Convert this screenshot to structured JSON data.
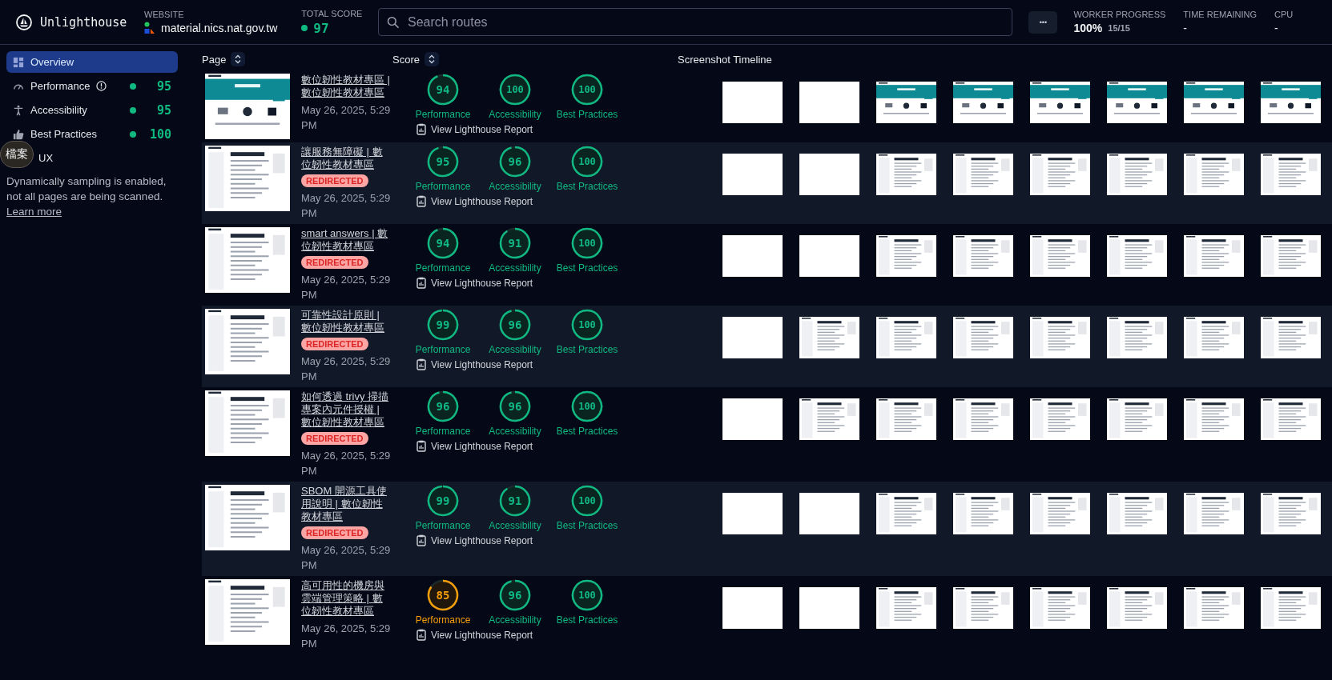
{
  "header": {
    "title": "Unlighthouse",
    "website_label": "WEBSITE",
    "website": "material.nics.nat.gov.tw",
    "total_score_label": "TOTAL SCORE",
    "total_score": "97",
    "search": {
      "placeholder": "Search routes"
    },
    "more_button": "•••",
    "worker_progress_label": "WORKER PROGRESS",
    "worker_progress": "100%",
    "worker_count": "15/15",
    "time_remaining_label": "TIME REMAINING",
    "time_remaining": "-",
    "cpu_label": "CPU",
    "cpu": "-"
  },
  "sidebar": {
    "items": [
      {
        "kind": "overview",
        "label": "Overview",
        "selected": true,
        "alert": false
      },
      {
        "kind": "performance",
        "label": "Performance",
        "selected": false,
        "alert": true,
        "score": "95"
      },
      {
        "kind": "accessibility",
        "label": "Accessibility",
        "selected": false,
        "alert": false,
        "score": "95"
      },
      {
        "kind": "best-practices",
        "label": "Best Practices",
        "selected": false,
        "alert": false,
        "score": "100"
      },
      {
        "kind": "ux",
        "label": "UX",
        "selected": false,
        "alert": false
      }
    ],
    "tooltip": "檔案",
    "note": "Dynamically sampling is enabled, not all pages are being scanned.",
    "note_link": "Learn more"
  },
  "table": {
    "columns": [
      "Page",
      "Score",
      "Screenshot Timeline"
    ],
    "rows": [
      {
        "title": "數位韌性教材專區 | 數位韌性教材專區",
        "redirected": false,
        "date": "May 26, 2025, 5:29 PM",
        "scores": [
          {
            "value": "94",
            "level": 0.94,
            "label": "Performance"
          },
          {
            "value": "100",
            "level": 1,
            "label": "Accessibility"
          },
          {
            "value": "100",
            "level": 1,
            "label": "Best Practices"
          }
        ],
        "report": "View Lighthouse Report",
        "timeline": [
          {
            "kind": "blank"
          },
          {
            "kind": "blank"
          },
          {
            "kind": "picture"
          },
          {
            "kind": "picture"
          },
          {
            "kind": "picture"
          },
          {
            "kind": "picture"
          },
          {
            "kind": "picture"
          },
          {
            "kind": "picture"
          }
        ]
      },
      {
        "title": "讓服務無障礙 | 數位韌性教材專區",
        "redirected": true,
        "redirect_label": "REDIRECTED",
        "date": "May 26, 2025, 5:29 PM",
        "scores": [
          {
            "value": "95",
            "level": 0.95,
            "label": "Performance"
          },
          {
            "value": "96",
            "level": 0.96,
            "label": "Accessibility"
          },
          {
            "value": "100",
            "level": 1,
            "label": "Best Practices"
          }
        ],
        "report": "View Lighthouse Report",
        "timeline": [
          {
            "kind": "blank"
          },
          {
            "kind": "blank"
          },
          {
            "kind": "picture"
          },
          {
            "kind": "picture"
          },
          {
            "kind": "picture"
          },
          {
            "kind": "picture"
          },
          {
            "kind": "picture"
          },
          {
            "kind": "picture"
          }
        ]
      },
      {
        "title": "smart answers | 數位韌性教材專區",
        "redirected": true,
        "redirect_label": "REDIRECTED",
        "date": "May 26, 2025, 5:29 PM",
        "scores": [
          {
            "value": "94",
            "level": 0.94,
            "label": "Performance"
          },
          {
            "value": "91",
            "level": 0.91,
            "label": "Accessibility"
          },
          {
            "value": "100",
            "level": 1,
            "label": "Best Practices"
          }
        ],
        "report": "View Lighthouse Report",
        "timeline": [
          {
            "kind": "blank"
          },
          {
            "kind": "blank"
          },
          {
            "kind": "picture"
          },
          {
            "kind": "picture"
          },
          {
            "kind": "picture"
          },
          {
            "kind": "picture"
          },
          {
            "kind": "picture"
          },
          {
            "kind": "picture"
          }
        ]
      },
      {
        "title": "可靠性設計原則 | 數位韌性教材專區",
        "redirected": true,
        "redirect_label": "REDIRECTED",
        "date": "May 26, 2025, 5:29 PM",
        "scores": [
          {
            "value": "99",
            "level": 0.99,
            "label": "Performance"
          },
          {
            "value": "96",
            "level": 0.96,
            "label": "Accessibility"
          },
          {
            "value": "100",
            "level": 1,
            "label": "Best Practices"
          }
        ],
        "report": "View Lighthouse Report",
        "timeline": [
          {
            "kind": "blank"
          },
          {
            "kind": "picture"
          },
          {
            "kind": "picture"
          },
          {
            "kind": "picture"
          },
          {
            "kind": "picture"
          },
          {
            "kind": "picture"
          },
          {
            "kind": "picture"
          },
          {
            "kind": "picture"
          }
        ]
      },
      {
        "title": "如何透過 trivy 掃描專案內元件授權 | 數位韌性教材專區",
        "redirected": true,
        "redirect_label": "REDIRECTED",
        "date": "May 26, 2025, 5:29 PM",
        "scores": [
          {
            "value": "96",
            "level": 0.96,
            "label": "Performance"
          },
          {
            "value": "96",
            "level": 0.96,
            "label": "Accessibility"
          },
          {
            "value": "100",
            "level": 1,
            "label": "Best Practices"
          }
        ],
        "report": "View Lighthouse Report",
        "timeline": [
          {
            "kind": "blank"
          },
          {
            "kind": "picture"
          },
          {
            "kind": "picture"
          },
          {
            "kind": "picture"
          },
          {
            "kind": "picture"
          },
          {
            "kind": "picture"
          },
          {
            "kind": "picture"
          },
          {
            "kind": "picture"
          }
        ]
      },
      {
        "title": "SBOM 開源工具使用說明 | 數位韌性教材專區",
        "redirected": true,
        "redirect_label": "REDIRECTED",
        "date": "May 26, 2025, 5:29 PM",
        "scores": [
          {
            "value": "99",
            "level": 0.99,
            "label": "Performance"
          },
          {
            "value": "91",
            "level": 0.91,
            "label": "Accessibility"
          },
          {
            "value": "100",
            "level": 1,
            "label": "Best Practices"
          }
        ],
        "report": "View Lighthouse Report",
        "timeline": [
          {
            "kind": "blank"
          },
          {
            "kind": "blank"
          },
          {
            "kind": "picture"
          },
          {
            "kind": "picture"
          },
          {
            "kind": "picture"
          },
          {
            "kind": "picture"
          },
          {
            "kind": "picture"
          },
          {
            "kind": "picture"
          }
        ]
      },
      {
        "title": "高可用性的機房與雲端管理策略 | 數位韌性教材專區",
        "redirected": false,
        "date": "May 26, 2025, 5:29 PM",
        "scores": [
          {
            "value": "85",
            "level": 0.85,
            "label": "Performance"
          },
          {
            "value": "96",
            "level": 0.96,
            "label": "Accessibility"
          },
          {
            "value": "100",
            "level": 1,
            "label": "Best Practices"
          }
        ],
        "report": "View Lighthouse Report",
        "timeline": [
          {
            "kind": "blank"
          },
          {
            "kind": "blank"
          },
          {
            "kind": "picture"
          },
          {
            "kind": "picture"
          },
          {
            "kind": "picture"
          },
          {
            "kind": "picture"
          },
          {
            "kind": "picture"
          },
          {
            "kind": "picture"
          }
        ]
      }
    ]
  }
}
